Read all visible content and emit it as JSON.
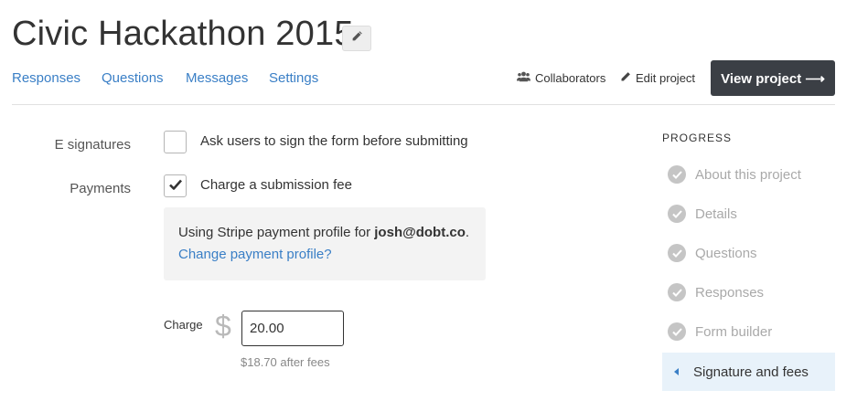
{
  "header": {
    "title": "Civic Hackathon 2015",
    "edit_icon": "pencil-icon"
  },
  "nav": {
    "tabs": [
      {
        "label": "Responses"
      },
      {
        "label": "Questions"
      },
      {
        "label": "Messages"
      },
      {
        "label": "Settings"
      }
    ],
    "link_color": "#3a7fc6"
  },
  "actions": {
    "collaborators": {
      "label": "Collaborators",
      "icon": "users-icon"
    },
    "edit_project": {
      "label": "Edit project",
      "icon": "pencil-icon"
    },
    "view_project": {
      "label": "View project ⟶",
      "bg_color": "#3b3f45"
    }
  },
  "form": {
    "esignatures": {
      "label": "E signatures",
      "checked": false,
      "text": "Ask users to sign the form before submitting"
    },
    "payments": {
      "label": "Payments",
      "checked": true,
      "text": "Charge a submission fee"
    },
    "stripe": {
      "prefix": "Using Stripe payment profile for ",
      "email": "josh@dobt.co",
      "suffix": ".",
      "change_link": "Change payment profile?"
    },
    "charge": {
      "label": "Charge",
      "currency_symbol": "$",
      "value": "20.00",
      "after_fees": "$18.70 after fees"
    }
  },
  "progress": {
    "title": "PROGRESS",
    "items": [
      {
        "label": "About this project",
        "status": "done"
      },
      {
        "label": "Details",
        "status": "done"
      },
      {
        "label": "Questions",
        "status": "done"
      },
      {
        "label": "Responses",
        "status": "done"
      },
      {
        "label": "Form builder",
        "status": "done"
      },
      {
        "label": "Signature and fees",
        "status": "current"
      }
    ],
    "active_bg": "#e8f2fa"
  }
}
